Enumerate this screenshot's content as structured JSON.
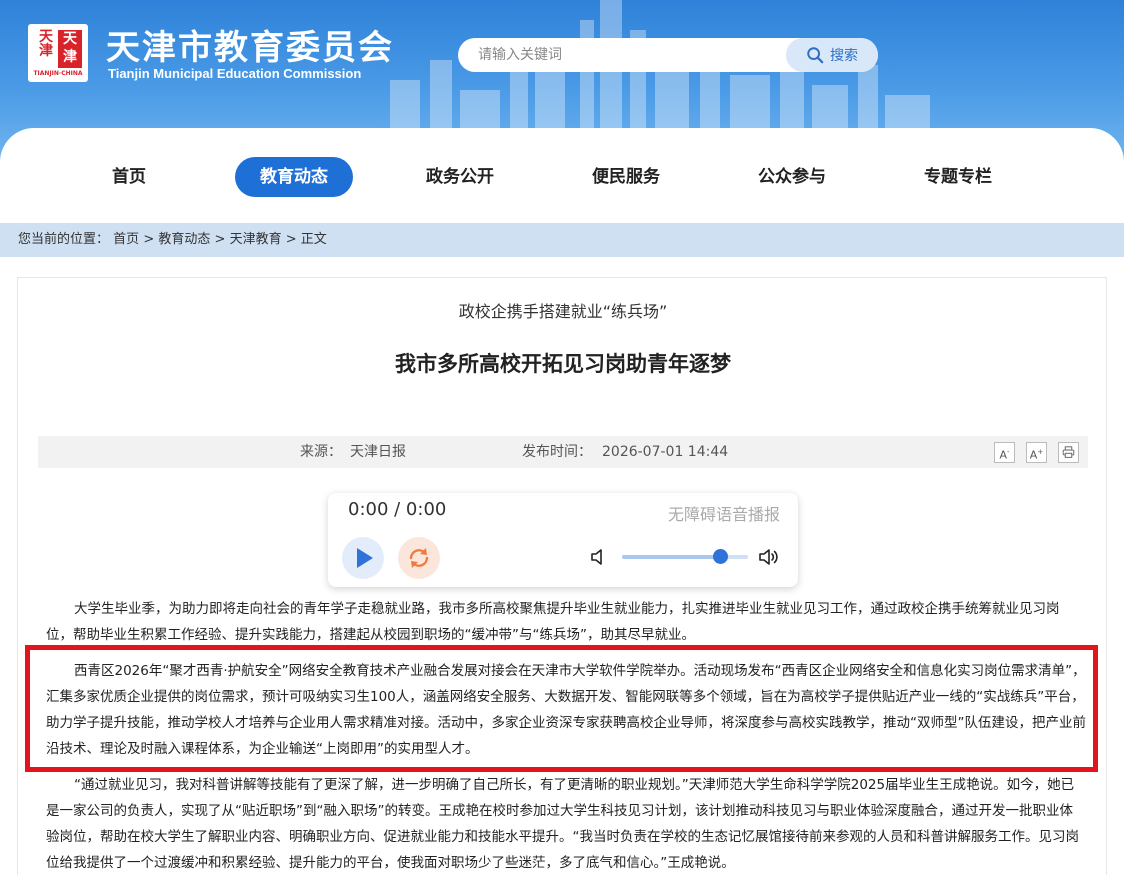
{
  "header": {
    "logo_text": "天津 TIANJIN CHINA",
    "title": "天津市教育委员会",
    "subtitle": "Tianjin Municipal Education Commission",
    "search_placeholder": "请输入关键词",
    "search_button": "搜索"
  },
  "nav": {
    "items": [
      {
        "label": "首页",
        "active": false
      },
      {
        "label": "教育动态",
        "active": true
      },
      {
        "label": "政务公开",
        "active": false
      },
      {
        "label": "便民服务",
        "active": false
      },
      {
        "label": "公众参与",
        "active": false
      },
      {
        "label": "专题专栏",
        "active": false
      }
    ]
  },
  "breadcrumb": {
    "prefix": "您当前的位置：",
    "items": [
      "首页",
      "教育动态",
      "天津教育",
      "正文"
    ],
    "separator": ">"
  },
  "article": {
    "subtitle": "政校企携手搭建就业“练兵场”",
    "title": "我市多所高校开拓见习岗助青年逐梦",
    "source_label": "来源：",
    "source": "天津日报",
    "time_label": "发布时间：",
    "time": "2026-07-01 14:44",
    "tools": [
      "A-",
      "A+",
      "print"
    ]
  },
  "player": {
    "time": "0:00 / 0:00",
    "label": "无障碍语音播报",
    "volume": 0.78
  },
  "paragraphs": [
    "大学生毕业季，为助力即将走向社会的青年学子走稳就业路，我市多所高校聚焦提升毕业生就业能力，扎实推进毕业生就业见习工作，通过政校企携手统筹就业见习岗位，帮助毕业生积累工作经验、提升实践能力，搭建起从校园到职场的“缓冲带”与“练兵场”，助其尽早就业。",
    "西青区2026年“聚才西青·护航安全”网络安全教育技术产业融合发展对接会在天津市大学软件学院举办。活动现场发布“西青区企业网络安全和信息化实习岗位需求清单”，汇集多家优质企业提供的岗位需求，预计可吸纳实习生100人，涵盖网络安全服务、大数据开发、智能网联等多个领域，旨在为高校学子提供贴近产业一线的“实战练兵”平台，助力学子提升技能，推动学校人才培养与企业用人需求精准对接。活动中，多家企业资深专家获聘高校企业导师，将深度参与高校实践教学，推动“双师型”队伍建设，把产业前沿技术、理论及时融入课程体系，为企业输送“上岗即用”的实用型人才。",
    "“通过就业见习，我对科普讲解等技能有了更深了解，进一步明确了自己所长，有了更清晰的职业规划。”天津师范大学生命科学学院2025届毕业生王成艳说。如今，她已是一家公司的负责人，实现了从“贴近职场”到“融入职场”的转变。王成艳在校时参加过大学生科技见习计划，该计划推动科技见习与职业体验深度融合，通过开发一批职业体验岗位，帮助在校大学生了解职业内容、明确职业方向、促进就业能力和技能水平提升。“我当时负责在学校的生态记忆展馆接待前来参观的人员和科普讲解服务工作。见习岗位给我提供了一个过渡缓冲和积累经验、提升能力的平台，使我面对职场少了些迷茫，多了底气和信心。”王成艳说。"
  ],
  "colors": {
    "header_blue": "#2f82d9",
    "nav_active": "#1e6fd6",
    "highlight_border": "#e3141d",
    "crumb_bg": "#cfe0f2"
  }
}
